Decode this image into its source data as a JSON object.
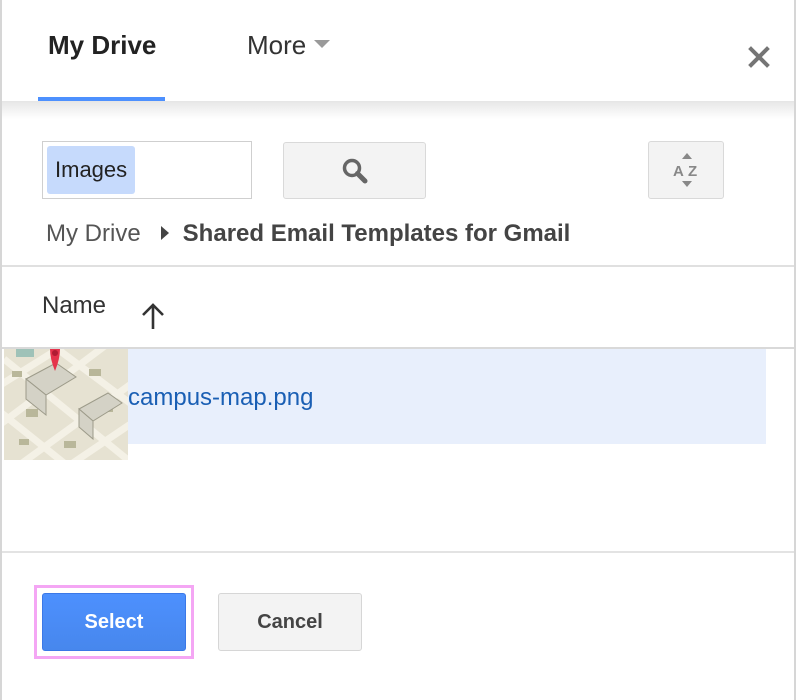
{
  "header": {
    "tabs": [
      {
        "label": "My Drive",
        "active": true
      },
      {
        "label": "More",
        "has_dropdown": true
      }
    ],
    "close_icon": "close-icon",
    "accent_color": "#4d90fe"
  },
  "search": {
    "chip_label": "Images",
    "search_icon": "search-icon",
    "sort_icon": "sort-az-icon"
  },
  "breadcrumb": {
    "root": "My Drive",
    "separator_icon": "triangle-right-icon",
    "current": "Shared Email Templates for Gmail"
  },
  "list": {
    "column_header": "Name",
    "sort_direction": "ascending",
    "items": [
      {
        "name": "campus-map.png",
        "thumbnail": "map-thumbnail",
        "selected": true
      }
    ]
  },
  "footer": {
    "select_label": "Select",
    "cancel_label": "Cancel",
    "select_color": "#4d90fe"
  }
}
